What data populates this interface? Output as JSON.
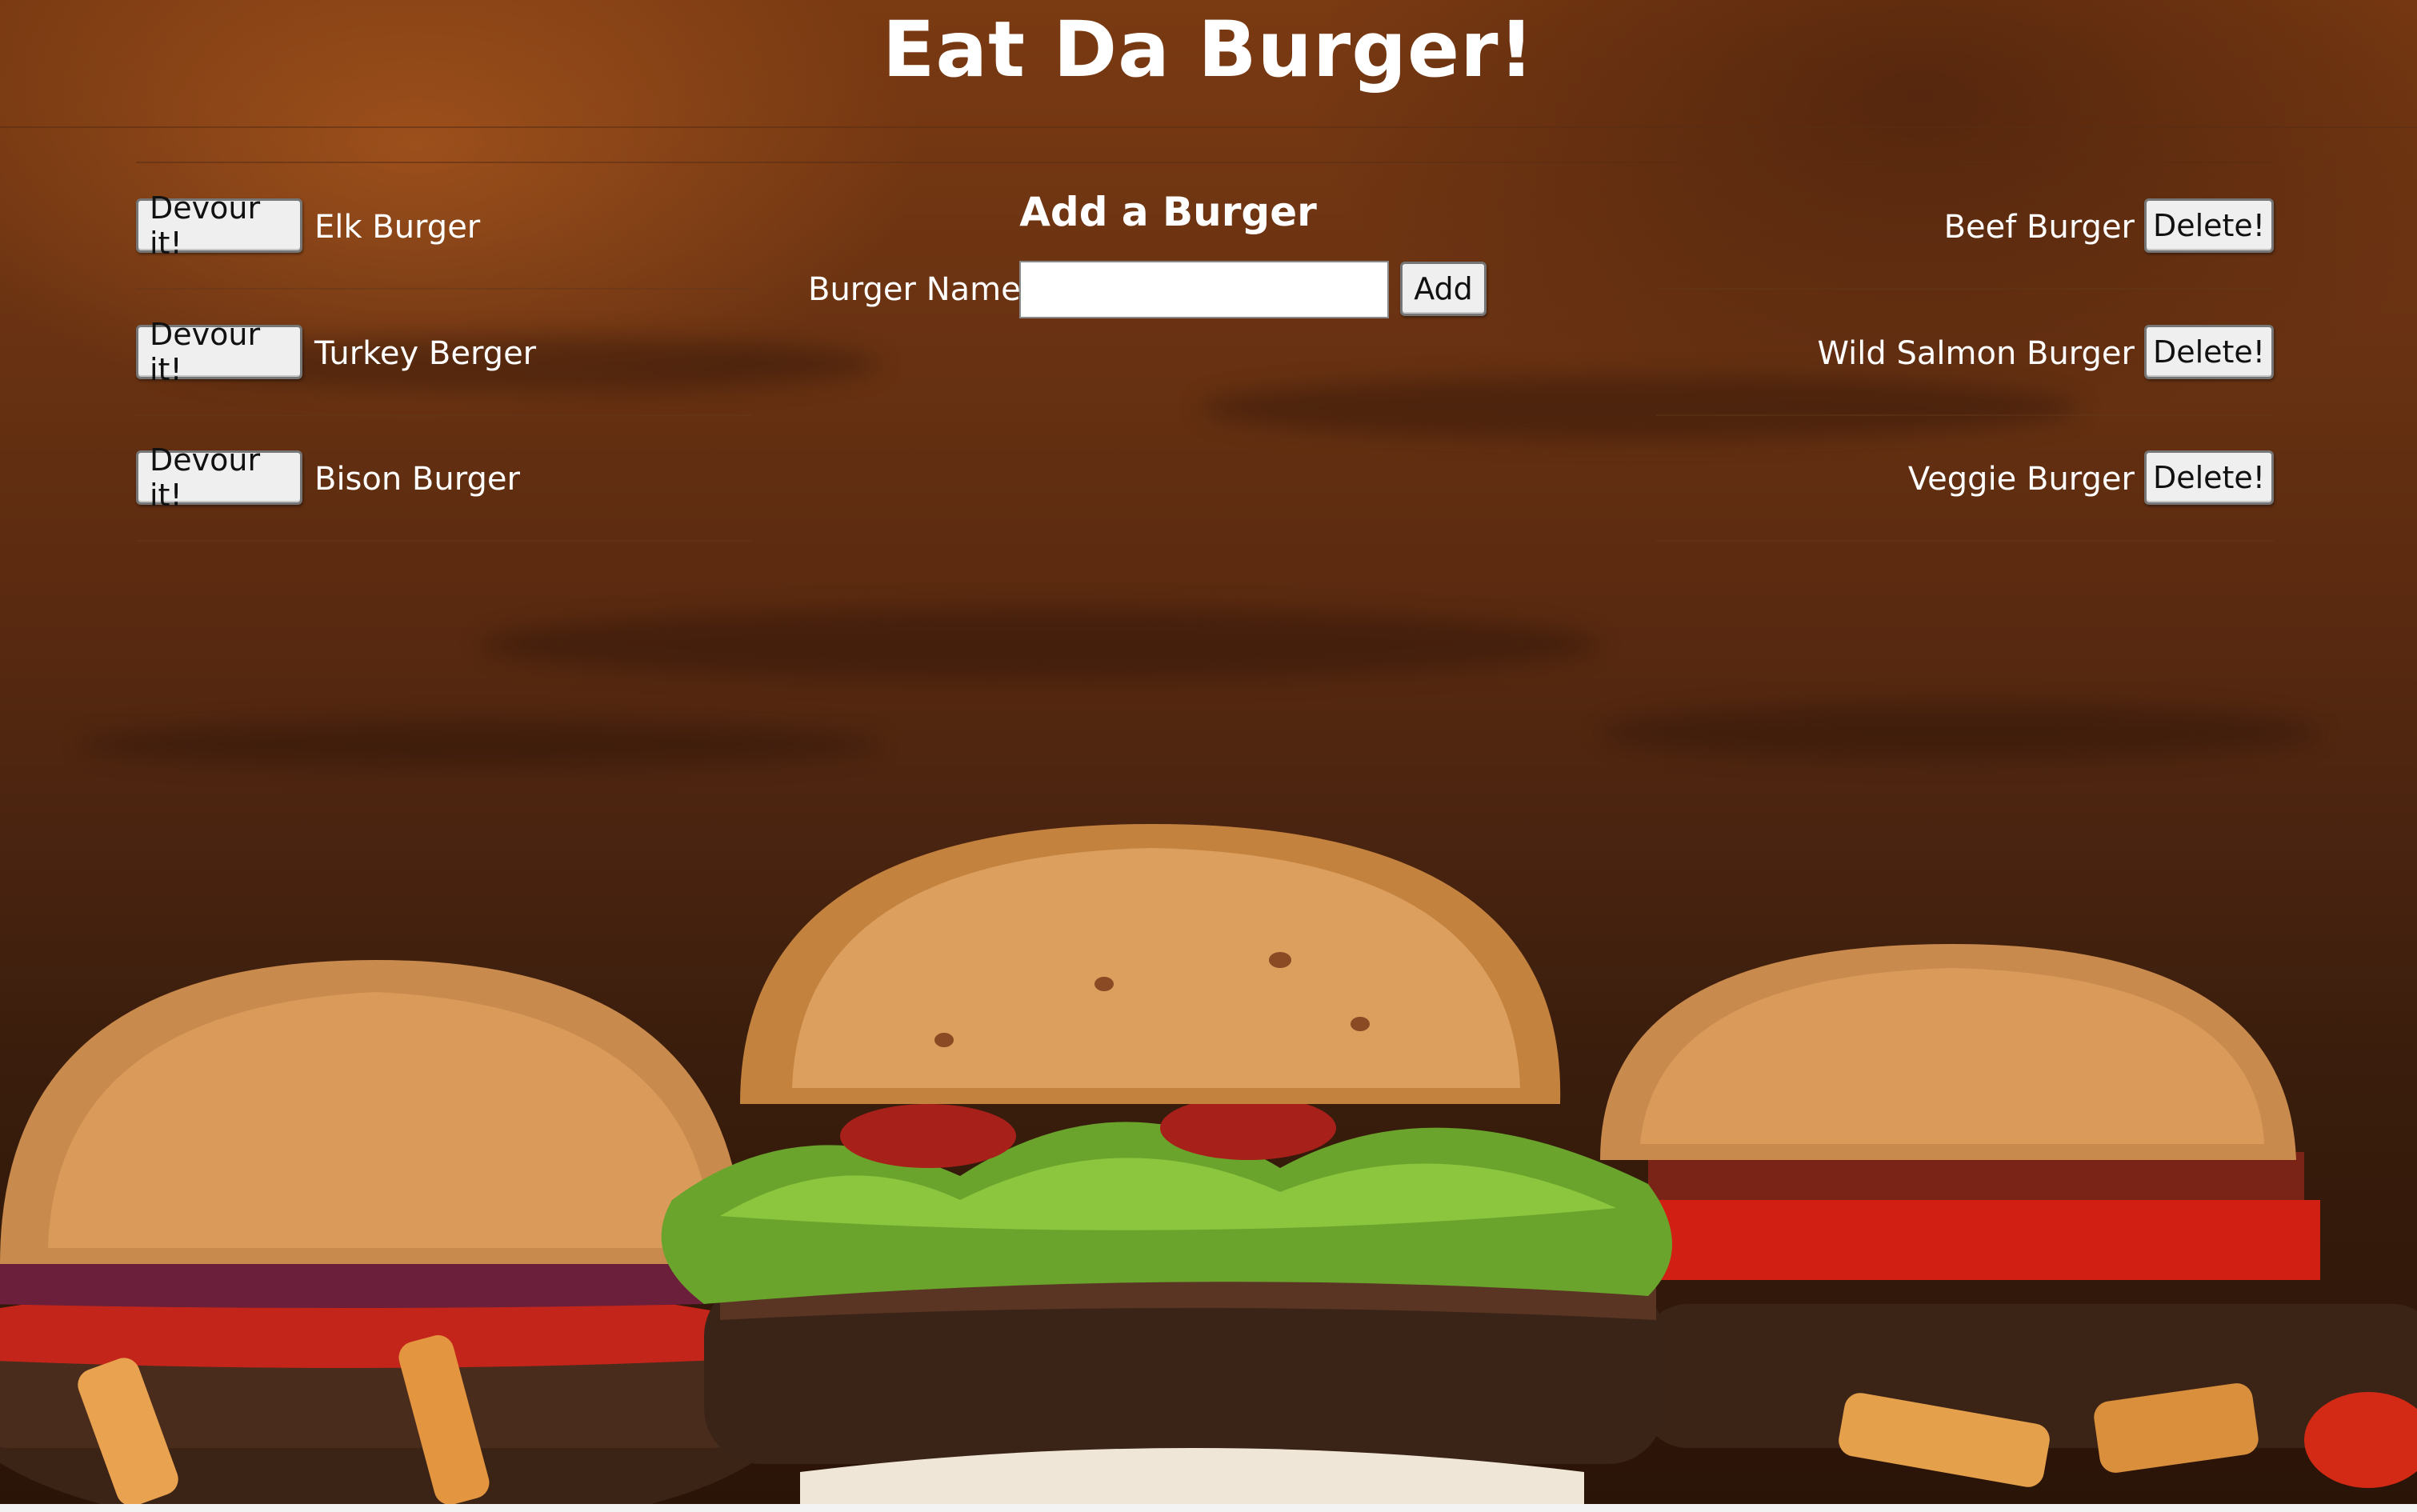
{
  "header": {
    "title": "Eat Da Burger!"
  },
  "uneaten": {
    "items": [
      {
        "name": "Elk Burger",
        "button_label": "Devour it!"
      },
      {
        "name": "Turkey Berger",
        "button_label": "Devour it!"
      },
      {
        "name": "Bison Burger",
        "button_label": "Devour it!"
      }
    ]
  },
  "add_form": {
    "heading": "Add a Burger",
    "field_label": "Burger Name:",
    "field_value": "",
    "submit_label": "Add"
  },
  "devoured": {
    "items": [
      {
        "name": "Beef Burger",
        "button_label": "Delete!"
      },
      {
        "name": "Wild Salmon Burger",
        "button_label": "Delete!"
      },
      {
        "name": "Veggie Burger",
        "button_label": "Delete!"
      }
    ]
  },
  "colors": {
    "text": "#ffffff",
    "button_bg": "#efefef",
    "wood_dark": "#3a1d0c",
    "wood_light": "#7a3a12"
  }
}
